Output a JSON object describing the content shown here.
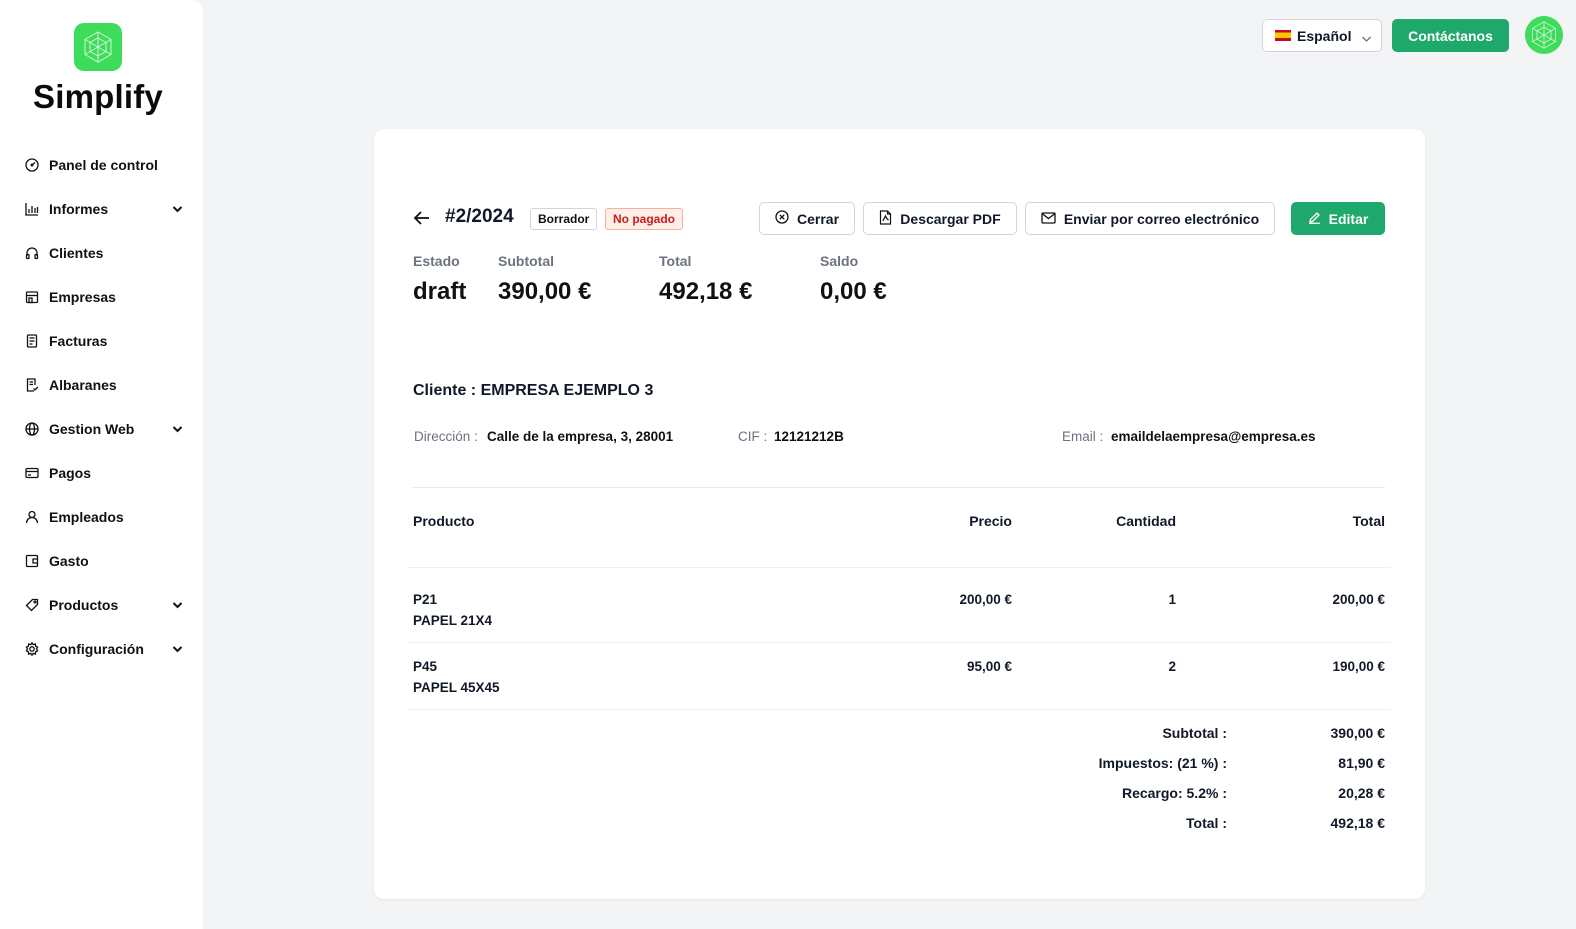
{
  "brand": {
    "name": "Simplify",
    "logo_icon": "hexagon-network-icon",
    "accent_color": "#3ddc5a",
    "primary_color": "#1fa86b"
  },
  "sidebar": {
    "items": [
      {
        "label": "Panel de control",
        "icon": "gauge-icon",
        "has_submenu": false
      },
      {
        "label": "Informes",
        "icon": "bar-chart-icon",
        "has_submenu": true
      },
      {
        "label": "Clientes",
        "icon": "headphones-icon",
        "has_submenu": false
      },
      {
        "label": "Empresas",
        "icon": "store-icon",
        "has_submenu": false
      },
      {
        "label": "Facturas",
        "icon": "receipt-icon",
        "has_submenu": false
      },
      {
        "label": "Albaranes",
        "icon": "document-check-icon",
        "has_submenu": false
      },
      {
        "label": "Gestion Web",
        "icon": "globe-icon",
        "has_submenu": true
      },
      {
        "label": "Pagos",
        "icon": "credit-card-icon",
        "has_submenu": false
      },
      {
        "label": "Empleados",
        "icon": "user-icon",
        "has_submenu": false
      },
      {
        "label": "Gasto",
        "icon": "wallet-icon",
        "has_submenu": false
      },
      {
        "label": "Productos",
        "icon": "tag-icon",
        "has_submenu": true
      },
      {
        "label": "Configuración",
        "icon": "gear-icon",
        "has_submenu": true
      }
    ]
  },
  "topbar": {
    "language": "Español",
    "flag_icon": "spain-flag-icon",
    "contact_label": "Contáctanos"
  },
  "invoice": {
    "number": "#2/2024",
    "badges": {
      "draft": "Borrador",
      "unpaid": "No pagado"
    },
    "actions": {
      "close": "Cerrar",
      "download_pdf": "Descargar PDF",
      "send_email": "Enviar por correo electrónico",
      "edit": "Editar"
    },
    "stats": [
      {
        "label": "Estado",
        "value": "draft"
      },
      {
        "label": "Subtotal",
        "value": "390,00 €"
      },
      {
        "label": "Total",
        "value": "492,18 €"
      },
      {
        "label": "Saldo",
        "value": "0,00 €"
      }
    ],
    "client": {
      "title": "Cliente : EMPRESA EJEMPLO 3",
      "address_label": "Dirección :",
      "address": "Calle de la empresa, 3, 28001",
      "cif_label": "CIF :",
      "cif": "12121212B",
      "email_label": "Email :",
      "email": "emaildelaempresa@empresa.es"
    },
    "table": {
      "headers": {
        "product": "Producto",
        "price": "Precio",
        "quantity": "Cantidad",
        "total": "Total"
      },
      "rows": [
        {
          "code": "P21",
          "name": "PAPEL 21X4",
          "price": "200,00 €",
          "quantity": "1",
          "total": "200,00 €"
        },
        {
          "code": "P45",
          "name": "PAPEL 45X45",
          "price": "95,00 €",
          "quantity": "2",
          "total": "190,00 €"
        }
      ]
    },
    "summary": [
      {
        "label": "Subtotal :",
        "value": "390,00 €"
      },
      {
        "label": "Impuestos: (21 %) :",
        "value": "81,90 €"
      },
      {
        "label": "Recargo: 5.2% :",
        "value": "20,28 €"
      },
      {
        "label": "Total :",
        "value": "492,18 €"
      }
    ]
  }
}
